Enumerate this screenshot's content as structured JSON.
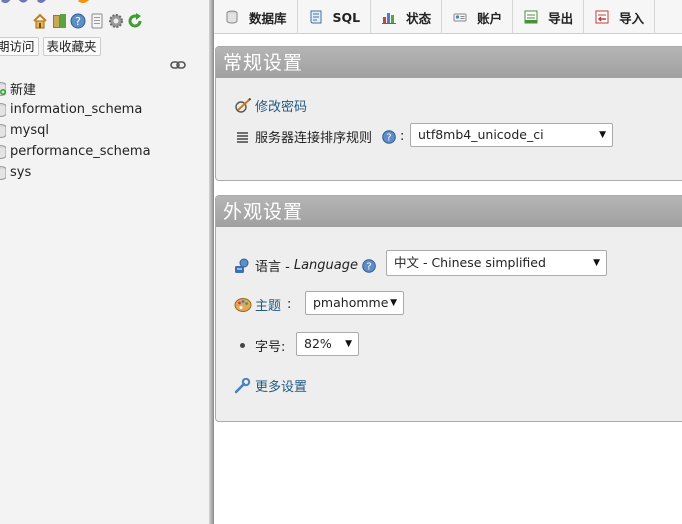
{
  "nav": {
    "icons": [
      "home-icon",
      "exit-icon",
      "help-icon",
      "docs-icon",
      "settings-icon",
      "reload-icon"
    ],
    "tabs": [
      "期访问",
      "表收藏夹"
    ],
    "databases": [
      "新建",
      "information_schema",
      "mysql",
      "performance_schema",
      "sys"
    ]
  },
  "tabs": [
    {
      "label": "数据库",
      "icon": "database-icon"
    },
    {
      "label": "SQL",
      "icon": "sql-icon"
    },
    {
      "label": "状态",
      "icon": "status-icon"
    },
    {
      "label": "账户",
      "icon": "users-icon"
    },
    {
      "label": "导出",
      "icon": "export-icon"
    },
    {
      "label": "导入",
      "icon": "import-icon"
    }
  ],
  "general": {
    "title": "常规设置",
    "change_password": "修改密码",
    "collation_label": "服务器连接排序规则",
    "collation_colon": ":",
    "collation_value": "utf8mb4_unicode_ci"
  },
  "appearance": {
    "title": "外观设置",
    "language_label": "语言 - ",
    "language_en": "Language",
    "language_value": "中文 - Chinese simplified",
    "theme_label": "主题",
    "theme_colon": ":",
    "theme_value": "pmahomme",
    "fontsize_label": "字号:",
    "fontsize_value": "82%",
    "more_settings": "更多设置"
  },
  "colors": {
    "link": "#235a81",
    "panel_header": "#a9a9a9",
    "logo_blue": "#6c78af",
    "logo_orange": "#f29111"
  }
}
